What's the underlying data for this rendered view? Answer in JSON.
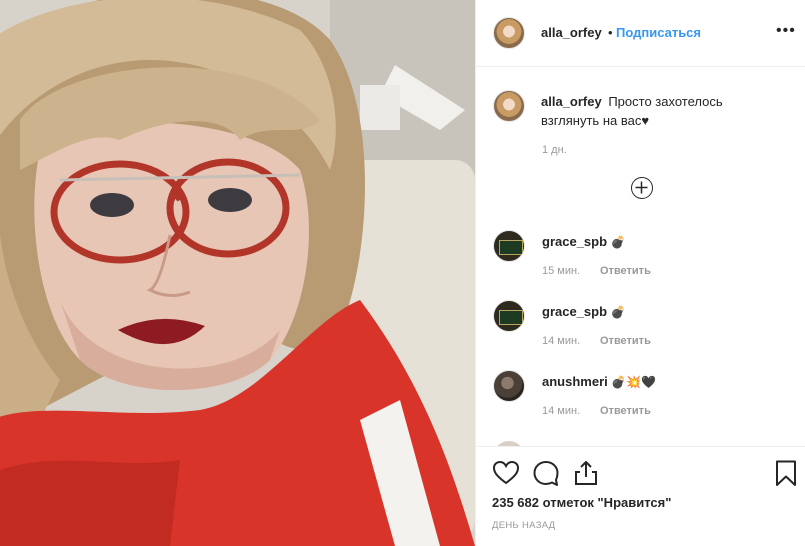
{
  "colors": {
    "link": "#3897f0",
    "muted": "#999999",
    "text": "#262626",
    "border": "#efefef"
  },
  "photo": {
    "description_icon": "selfie-photo"
  },
  "header": {
    "username": "alla_orfey",
    "separator": "•",
    "follow_label": "Подписаться",
    "more_label": "•••",
    "more_icon": "more-options-icon"
  },
  "caption": {
    "username": "alla_orfey",
    "text": "Просто захотелось взглянуть на вас",
    "emoji": "♥",
    "time": "1 дн."
  },
  "load_more": {
    "icon": "plus-circle-icon"
  },
  "comments": [
    {
      "username": "grace_spb",
      "text": "💣",
      "time": "15 мин.",
      "reply_label": "Ответить"
    },
    {
      "username": "grace_spb",
      "text": "💣",
      "time": "14 мин.",
      "reply_label": "Ответить"
    },
    {
      "username": "anushmeri",
      "text": "💣💥🖤",
      "time": "14 мин.",
      "reply_label": "Ответить"
    }
  ],
  "actions": {
    "icons": [
      "heart-icon",
      "comment-icon",
      "share-icon",
      "bookmark-icon"
    ],
    "likes": "235 682 отметок \"Нравится\"",
    "posted": "ДЕНЬ НАЗАД"
  }
}
